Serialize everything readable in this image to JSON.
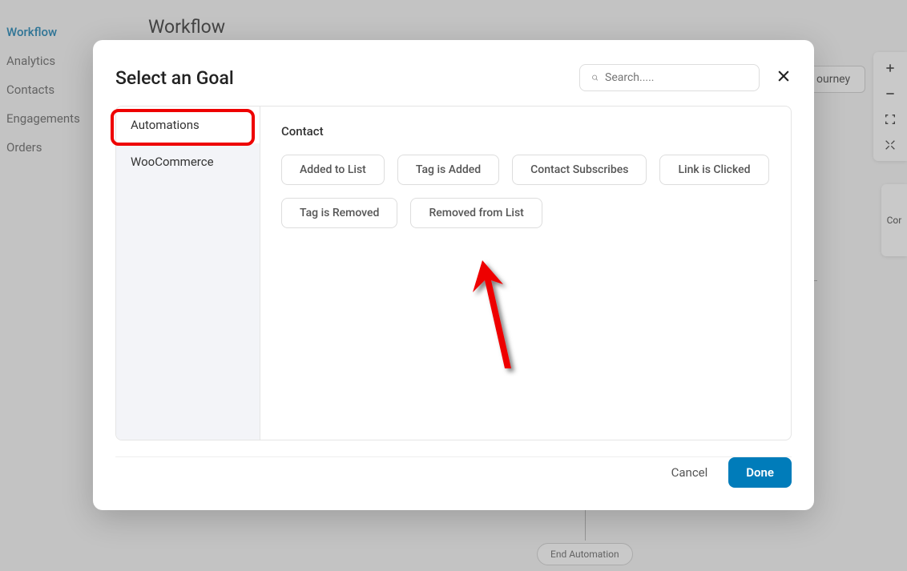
{
  "sidebar": {
    "items": [
      {
        "label": "Workflow",
        "active": true
      },
      {
        "label": "Analytics",
        "active": false
      },
      {
        "label": "Contacts",
        "active": false
      },
      {
        "label": "Engagements",
        "active": false
      },
      {
        "label": "Orders",
        "active": false
      }
    ]
  },
  "page": {
    "title": "Workflow",
    "journey_btn": "ourney",
    "end_automation": "End Automation",
    "right_label": "Cor"
  },
  "modal": {
    "title": "Select an Goal",
    "search_placeholder": "Search.....",
    "sidebar_items": [
      {
        "label": "Automations",
        "active": true
      },
      {
        "label": "WooCommerce",
        "active": false
      }
    ],
    "section_label": "Contact",
    "chips": [
      "Added to List",
      "Tag is Added",
      "Contact Subscribes",
      "Link is Clicked",
      "Tag is Removed",
      "Removed from List"
    ],
    "cancel_label": "Cancel",
    "done_label": "Done"
  }
}
